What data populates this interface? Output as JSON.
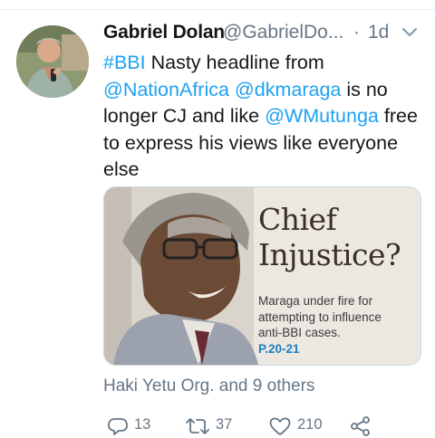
{
  "tweet": {
    "author_name": "Gabriel Dolan",
    "author_handle": "@GabrielDo...",
    "separator": "·",
    "time": "1d",
    "text_lines": [
      [
        {
          "text": "#BBI",
          "link": true
        },
        {
          "text": " Nasty headline from",
          "link": false
        }
      ],
      [
        {
          "text": "@NationAfrica",
          "link": true
        },
        {
          "text": " ",
          "link": false
        },
        {
          "text": "@dkmaraga",
          "link": true
        },
        {
          "text": " is no",
          "link": false
        }
      ],
      [
        {
          "text": "longer CJ and like ",
          "link": false
        },
        {
          "text": "@WMutunga",
          "link": true
        },
        {
          "text": " free",
          "link": false
        }
      ],
      [
        {
          "text": "to express his views like everyone",
          "link": false
        }
      ],
      [
        {
          "text": "else",
          "link": false
        }
      ]
    ],
    "media": {
      "headline_line1": "Chief",
      "headline_line2": "Injustice?",
      "subhead_line1": "Maraga under fire for",
      "subhead_line2": "attempting to influence",
      "subhead_line3": "anti-BBI cases.",
      "page_ref": "P.20-21"
    },
    "social_context": "Haki Yetu Org. and 9 others",
    "actions": {
      "replies": "13",
      "retweets": "37",
      "likes": "210"
    }
  },
  "colors": {
    "link": "#1da1f2",
    "muted": "#657786",
    "text": "#14171a"
  }
}
